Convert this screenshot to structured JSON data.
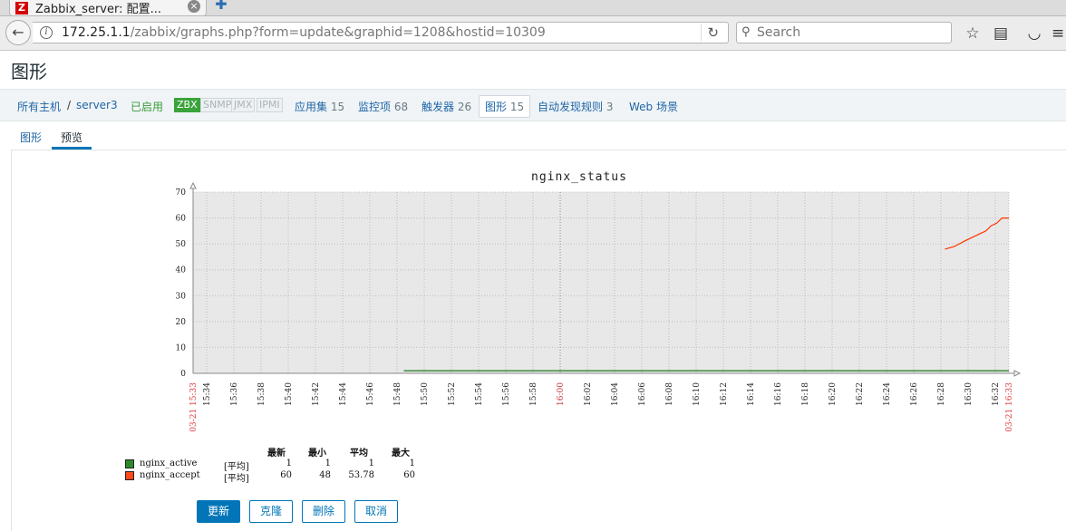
{
  "browser": {
    "tab_title": "Zabbix_server: 配置...",
    "favicon_letter": "Z",
    "tab_close": "×",
    "newtab": "✚",
    "url_host": "172.25.1.1",
    "url_path": "/zabbix/graphs.php?form=update&graphid=1208&hostid=10309",
    "search_placeholder": "Search"
  },
  "page": {
    "title": "图形"
  },
  "hostbar": {
    "all_hosts": "所有主机",
    "separator": "/",
    "host": "server3",
    "status": "已启用",
    "badges": [
      "ZBX",
      "SNMP",
      "JMX",
      "IPMI"
    ],
    "applications": {
      "label": "应用集",
      "count": "15"
    },
    "items": {
      "label": "监控项",
      "count": "68"
    },
    "triggers": {
      "label": "触发器",
      "count": "26"
    },
    "graphs": {
      "label": "图形",
      "count": "15"
    },
    "discovery": {
      "label": "自动发现规则",
      "count": "3"
    },
    "web": {
      "label": "Web 场景"
    }
  },
  "subtabs": {
    "graph": "图形",
    "preview": "预览"
  },
  "chart_data": {
    "type": "line",
    "title": "nginx_status",
    "ylim": [
      0,
      70
    ],
    "yticks": [
      "0",
      "10",
      "20",
      "30",
      "40",
      "50",
      "60",
      "70"
    ],
    "x_time_labels": [
      "15:34",
      "15:36",
      "15:38",
      "15:40",
      "15:42",
      "15:44",
      "15:46",
      "15:48",
      "15:50",
      "15:52",
      "15:54",
      "15:56",
      "15:58",
      "16:00",
      "16:02",
      "16:04",
      "16:06",
      "16:08",
      "16:10",
      "16:12",
      "16:14",
      "16:16",
      "16:18",
      "16:20",
      "16:22",
      "16:24",
      "16:26",
      "16:28",
      "16:30",
      "16:32"
    ],
    "x_range_labels": [
      "03-21 15:33",
      "03-21 16:33"
    ],
    "grid": true,
    "series": [
      {
        "name": "nginx_active",
        "color": "#1a7a1a",
        "x_minutes": [
          15.5,
          60
        ],
        "values": [
          1,
          1
        ]
      },
      {
        "name": "nginx_accept",
        "color": "#ff3300",
        "x_minutes": [
          55.3,
          56.0,
          56.7,
          57.1,
          57.5,
          57.9,
          58.3,
          58.7,
          59.1,
          59.5,
          60
        ],
        "values": [
          48,
          49,
          51,
          52,
          53,
          54,
          55,
          57,
          58,
          60,
          60
        ]
      }
    ],
    "legend": {
      "headers": [
        "最新",
        "最小",
        "平均",
        "最大"
      ],
      "rows": [
        {
          "name": "nginx_active",
          "func": "[平均]",
          "last": "1",
          "min": "1",
          "avg": "1",
          "max": "1",
          "color": "#2b8a2b"
        },
        {
          "name": "nginx_accept",
          "func": "[平均]",
          "last": "60",
          "min": "48",
          "avg": "53.78",
          "max": "60",
          "color": "#ff4a1a"
        }
      ]
    }
  },
  "buttons": {
    "update": "更新",
    "clone": "克隆",
    "delete": "删除",
    "cancel": "取消"
  }
}
